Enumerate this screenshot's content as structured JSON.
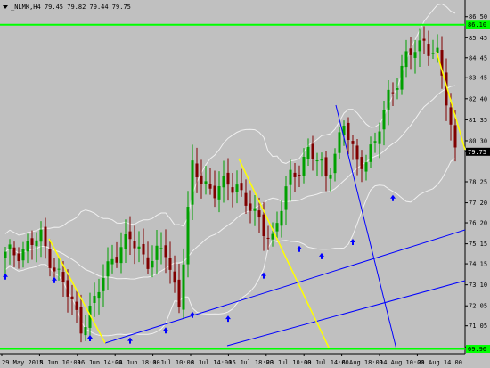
{
  "header": {
    "symbol": "_NLMK,H4",
    "ohlc": "79.45 79.82 79.44 79.75"
  },
  "colors": {
    "background": "#c0c0c0",
    "axis": "#000000",
    "bullish": "#00a000",
    "bearish": "#800000",
    "bands": "#f0f0f0",
    "level_line": "#00ff00",
    "trend_line": "#0000ff",
    "fan_line": "#ffff00",
    "arrow": "#0000ff",
    "price_tag_bg": "#000000",
    "price_tag_fg": "#ffffff"
  },
  "chart_data": {
    "type": "candlestick",
    "title": "_NLMK,H4",
    "y_range": [
      69.7,
      86.8
    ],
    "y_ticks": [
      "86.50",
      "85.45",
      "84.45",
      "83.45",
      "82.40",
      "81.35",
      "80.30",
      "79.75",
      "78.25",
      "77.20",
      "76.20",
      "75.15",
      "74.15",
      "73.10",
      "72.05",
      "71.05",
      "70.00"
    ],
    "x_labels": [
      "29 May 2015",
      "8 Jun 10:00",
      "16 Jun 14:00",
      "24 Jun 18:00",
      "1 Jul 10:00",
      "8 Jul 14:00",
      "15 Jul 18:00",
      "23 Jul 10:00",
      "30 Jul 14:00",
      "6 Aug 18:00",
      "14 Aug 10:00",
      "21 Aug 14:00"
    ],
    "current_price": "79.75",
    "level_price": "86.10",
    "level_label": "86.10",
    "bottom_level_price": "69.90",
    "bottom_level_label": "69.90",
    "anchor_prices": [
      {
        "i": 0,
        "p": 74.5
      },
      {
        "i": 8,
        "p": 75.4
      },
      {
        "i": 12,
        "p": 73.6
      },
      {
        "i": 17,
        "p": 71.1
      },
      {
        "i": 20,
        "p": 72.2
      },
      {
        "i": 24,
        "p": 74.6
      },
      {
        "i": 28,
        "p": 75.3
      },
      {
        "i": 32,
        "p": 74.4
      },
      {
        "i": 36,
        "p": 74.7
      },
      {
        "i": 39,
        "p": 72.3
      },
      {
        "i": 42,
        "p": 78.8
      },
      {
        "i": 47,
        "p": 77.8
      },
      {
        "i": 52,
        "p": 78.2
      },
      {
        "i": 56,
        "p": 76.4
      },
      {
        "i": 60,
        "p": 75.5
      },
      {
        "i": 64,
        "p": 78.4
      },
      {
        "i": 68,
        "p": 79.8
      },
      {
        "i": 72,
        "p": 78.6
      },
      {
        "i": 76,
        "p": 81.0
      },
      {
        "i": 79,
        "p": 79.2
      },
      {
        "i": 83,
        "p": 80.0
      },
      {
        "i": 86,
        "p": 82.6
      },
      {
        "i": 90,
        "p": 84.3
      },
      {
        "i": 94,
        "p": 85.4
      },
      {
        "i": 97,
        "p": 84.4
      },
      {
        "i": 99,
        "p": 82.3
      },
      {
        "i": 101,
        "p": 79.9
      }
    ],
    "arrow_indices": [
      0,
      11,
      19,
      28,
      36,
      42,
      50,
      58,
      66,
      71,
      78,
      87
    ]
  }
}
